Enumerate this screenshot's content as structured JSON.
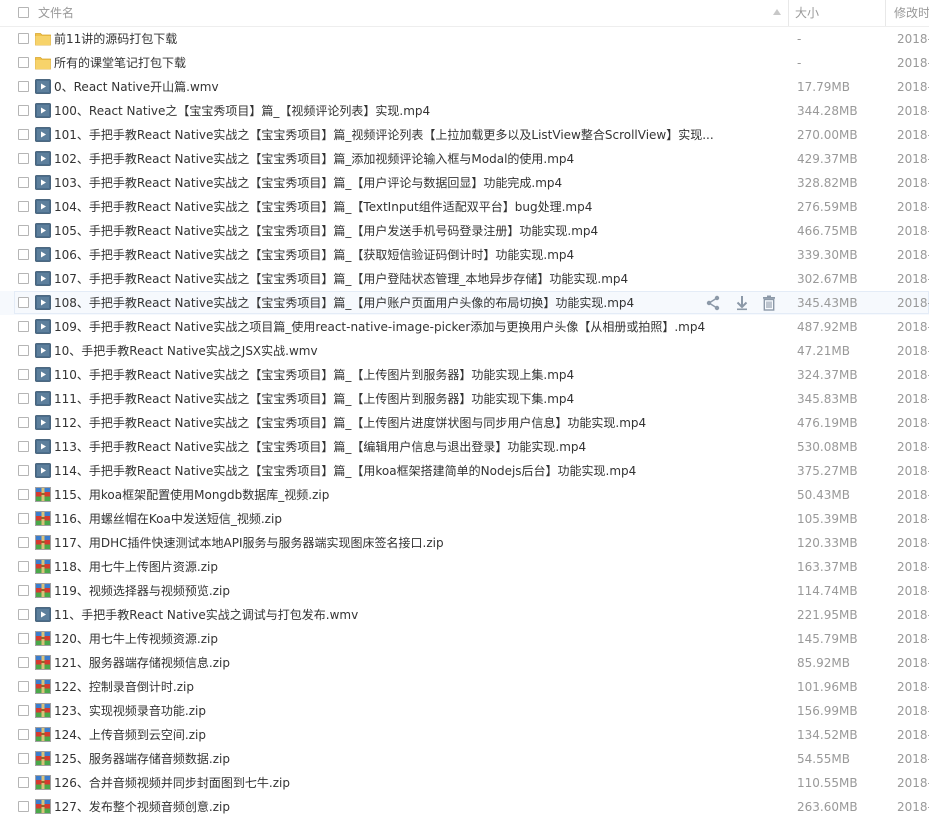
{
  "header": {
    "name_label": "文件名",
    "size_label": "大小",
    "date_label": "修改时"
  },
  "colors": {
    "folder": "#f0c24a",
    "video": "#4a6d8c",
    "archive_blue": "#3c7dcc",
    "archive_red": "#d63a2f",
    "archive_green": "#4aa84a"
  },
  "rows": [
    {
      "icon": "folder-icon",
      "name": "前11讲的源码打包下载",
      "size": "-",
      "date": "2018-"
    },
    {
      "icon": "folder-icon",
      "name": "所有的课堂笔记打包下载",
      "size": "-",
      "date": "2018-"
    },
    {
      "icon": "video-file-icon",
      "name": "0、React Native开山篇.wmv",
      "size": "17.79MB",
      "date": "2018-"
    },
    {
      "icon": "video-file-icon",
      "name": "100、React Native之【宝宝秀项目】篇_【视频评论列表】实现.mp4",
      "size": "344.28MB",
      "date": "2018-"
    },
    {
      "icon": "video-file-icon",
      "name": "101、手把手教React Native实战之【宝宝秀项目】篇_视频评论列表【上拉加载更多以及ListView整合ScrollView】实现....",
      "size": "270.00MB",
      "date": "2018-"
    },
    {
      "icon": "video-file-icon",
      "name": "102、手把手教React Native实战之【宝宝秀项目】篇_添加视频评论输入框与Modal的使用.mp4",
      "size": "429.37MB",
      "date": "2018-"
    },
    {
      "icon": "video-file-icon",
      "name": "103、手把手教React Native实战之【宝宝秀项目】篇_【用户评论与数据回显】功能完成.mp4",
      "size": "328.82MB",
      "date": "2018-"
    },
    {
      "icon": "video-file-icon",
      "name": "104、手把手教React Native实战之【宝宝秀项目】篇_【TextInput组件适配双平台】bug处理.mp4",
      "size": "276.59MB",
      "date": "2018-"
    },
    {
      "icon": "video-file-icon",
      "name": "105、手把手教React Native实战之【宝宝秀项目】篇_【用户发送手机号码登录注册】功能实现.mp4",
      "size": "466.75MB",
      "date": "2018-"
    },
    {
      "icon": "video-file-icon",
      "name": "106、手把手教React Native实战之【宝宝秀项目】篇_【获取短信验证码倒计时】功能实现.mp4",
      "size": "339.30MB",
      "date": "2018-"
    },
    {
      "icon": "video-file-icon",
      "name": "107、手把手教React Native实战之【宝宝秀项目】篇_【用户登陆状态管理_本地异步存储】功能实现.mp4",
      "size": "302.67MB",
      "date": "2018-"
    },
    {
      "icon": "video-file-icon",
      "name": "108、手把手教React Native实战之【宝宝秀项目】篇_【用户账户页面用户头像的布局切换】功能实现.mp4",
      "size": "345.43MB",
      "date": "2018-",
      "hovered": true
    },
    {
      "icon": "video-file-icon",
      "name": "109、手把手教React Native实战之项目篇_使用react-native-image-picker添加与更换用户头像【从相册或拍照】.mp4",
      "size": "487.92MB",
      "date": "2018-"
    },
    {
      "icon": "video-file-icon",
      "name": "10、手把手教React Native实战之JSX实战.wmv",
      "size": "47.21MB",
      "date": "2018-"
    },
    {
      "icon": "video-file-icon",
      "name": "110、手把手教React Native实战之【宝宝秀项目】篇_【上传图片到服务器】功能实现上集.mp4",
      "size": "324.37MB",
      "date": "2018-"
    },
    {
      "icon": "video-file-icon",
      "name": "111、手把手教React Native实战之【宝宝秀项目】篇_【上传图片到服务器】功能实现下集.mp4",
      "size": "345.83MB",
      "date": "2018-"
    },
    {
      "icon": "video-file-icon",
      "name": "112、手把手教React Native实战之【宝宝秀项目】篇_【上传图片进度饼状图与同步用户信息】功能实现.mp4",
      "size": "476.19MB",
      "date": "2018-"
    },
    {
      "icon": "video-file-icon",
      "name": "113、手把手教React Native实战之【宝宝秀项目】篇_【编辑用户信息与退出登录】功能实现.mp4",
      "size": "530.08MB",
      "date": "2018-"
    },
    {
      "icon": "video-file-icon",
      "name": "114、手把手教React Native实战之【宝宝秀项目】篇_【用koa框架搭建简单的Nodejs后台】功能实现.mp4",
      "size": "375.27MB",
      "date": "2018-"
    },
    {
      "icon": "archive-file-icon",
      "name": "115、用koa框架配置使用Mongdb数据库_视频.zip",
      "size": "50.43MB",
      "date": "2018-"
    },
    {
      "icon": "archive-file-icon",
      "name": "116、用螺丝帽在Koa中发送短信_视频.zip",
      "size": "105.39MB",
      "date": "2018-"
    },
    {
      "icon": "archive-file-icon",
      "name": "117、用DHC插件快速测试本地API服务与服务器端实现图床签名接口.zip",
      "size": "120.33MB",
      "date": "2018-"
    },
    {
      "icon": "archive-file-icon",
      "name": "118、用七牛上传图片资源.zip",
      "size": "163.37MB",
      "date": "2018-"
    },
    {
      "icon": "archive-file-icon",
      "name": "119、视频选择器与视频预览.zip",
      "size": "114.74MB",
      "date": "2018-"
    },
    {
      "icon": "video-file-icon",
      "name": "11、手把手教React Native实战之调试与打包发布.wmv",
      "size": "221.95MB",
      "date": "2018-"
    },
    {
      "icon": "archive-file-icon",
      "name": "120、用七牛上传视频资源.zip",
      "size": "145.79MB",
      "date": "2018-"
    },
    {
      "icon": "archive-file-icon",
      "name": "121、服务器端存储视频信息.zip",
      "size": "85.92MB",
      "date": "2018-"
    },
    {
      "icon": "archive-file-icon",
      "name": "122、控制录音倒计时.zip",
      "size": "101.96MB",
      "date": "2018-"
    },
    {
      "icon": "archive-file-icon",
      "name": "123、实现视频录音功能.zip",
      "size": "156.99MB",
      "date": "2018-"
    },
    {
      "icon": "archive-file-icon",
      "name": "124、上传音频到云空间.zip",
      "size": "134.52MB",
      "date": "2018-"
    },
    {
      "icon": "archive-file-icon",
      "name": "125、服务器端存储音频数据.zip",
      "size": "54.55MB",
      "date": "2018-"
    },
    {
      "icon": "archive-file-icon",
      "name": "126、合并音频视频并同步封面图到七牛.zip",
      "size": "110.55MB",
      "date": "2018-"
    },
    {
      "icon": "archive-file-icon",
      "name": "127、发布整个视频音频创意.zip",
      "size": "263.60MB",
      "date": "2018-"
    }
  ]
}
